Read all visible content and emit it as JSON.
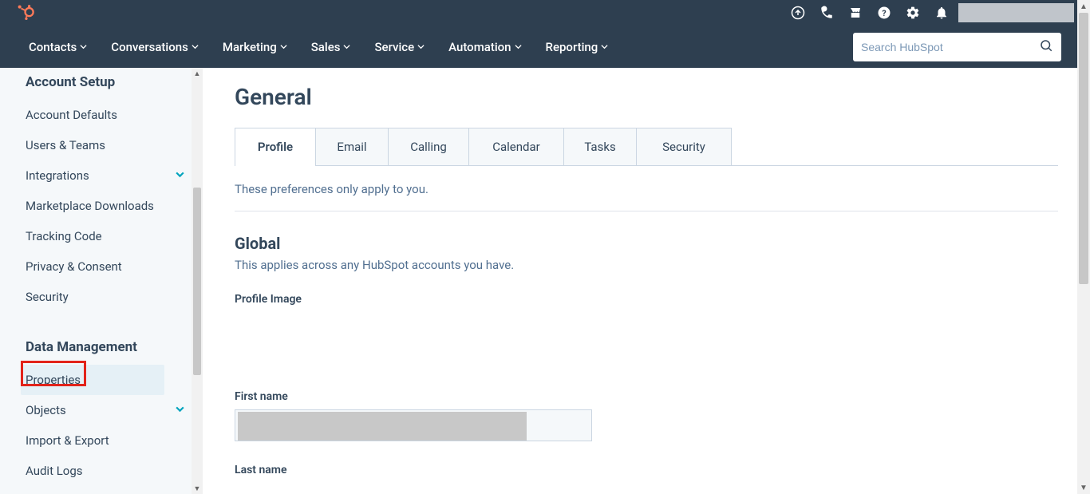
{
  "nav": {
    "items": [
      "Contacts",
      "Conversations",
      "Marketing",
      "Sales",
      "Service",
      "Automation",
      "Reporting"
    ]
  },
  "search": {
    "placeholder": "Search HubSpot"
  },
  "sidebar": {
    "heading_account": "Account Setup",
    "account_items": [
      "Account Defaults",
      "Users & Teams",
      "Integrations",
      "Marketplace Downloads",
      "Tracking Code",
      "Privacy & Consent",
      "Security"
    ],
    "heading_data": "Data Management",
    "data_items": [
      "Properties",
      "Objects",
      "Import & Export",
      "Audit Logs"
    ]
  },
  "page": {
    "title": "General",
    "tabs": [
      "Profile",
      "Email",
      "Calling",
      "Calendar",
      "Tasks",
      "Security"
    ],
    "pref_note": "These preferences only apply to you.",
    "global_title": "Global",
    "global_desc": "This applies across any HubSpot accounts you have.",
    "profile_image_label": "Profile Image",
    "first_name_label": "First name",
    "last_name_label": "Last name"
  }
}
